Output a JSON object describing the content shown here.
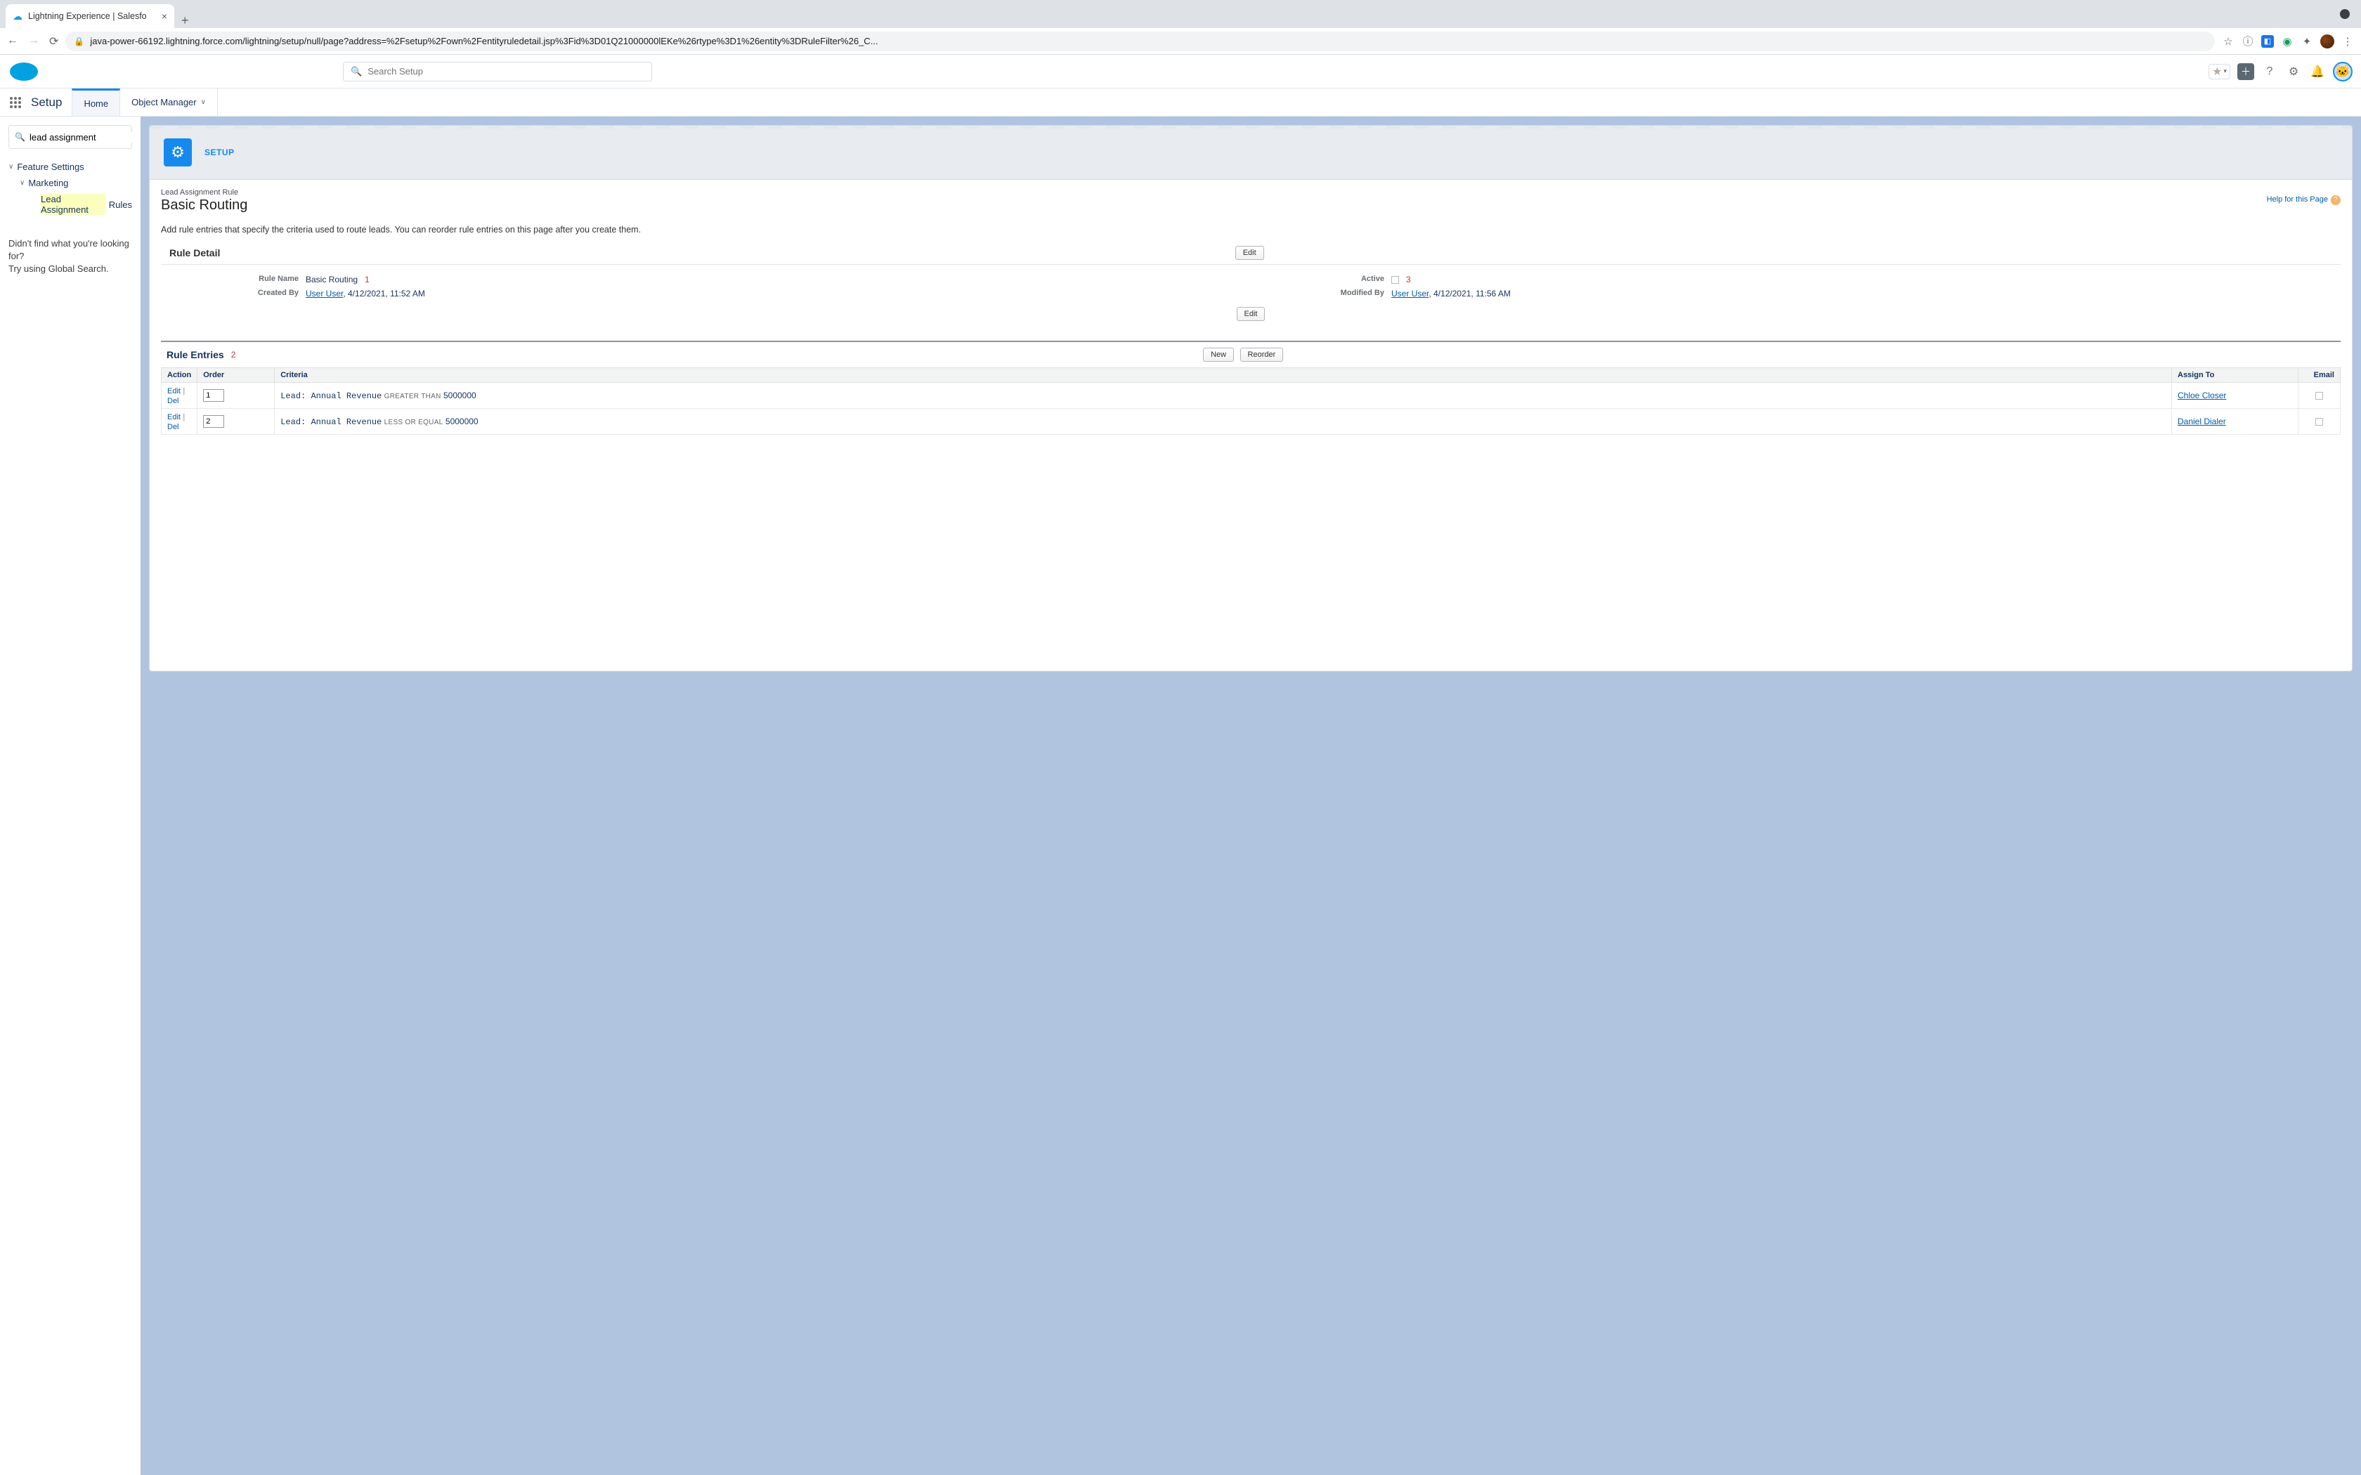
{
  "browser": {
    "tab_title": "Lightning Experience | Salesfo",
    "url": "java-power-66192.lightning.force.com/lightning/setup/null/page?address=%2Fsetup%2Fown%2Fentityruledetail.jsp%3Fid%3D01Q21000000lEKe%26rtype%3D1%26entity%3DRuleFilter%26_C..."
  },
  "globalHeader": {
    "search_placeholder": "Search Setup"
  },
  "contextBar": {
    "app_title": "Setup",
    "tab_home": "Home",
    "tab_object_manager": "Object Manager"
  },
  "sidebar": {
    "search_value": "lead assignment",
    "tree": {
      "feature_settings": "Feature Settings",
      "marketing": "Marketing",
      "lead_assignment_highlight": "Lead Assignment",
      "lead_assignment_rest": " Rules"
    },
    "not_found_line1": "Didn't find what you're looking for?",
    "not_found_line2": "Try using Global Search."
  },
  "banner": {
    "label": "SETUP"
  },
  "page": {
    "subtitle": "Lead Assignment Rule",
    "title": "Basic Routing",
    "help_text": "Help for this Page",
    "description": "Add rule entries that specify the criteria used to route leads. You can reorder rule entries on this page after you create them."
  },
  "ruleDetail": {
    "section": "Rule Detail",
    "edit": "Edit",
    "labels": {
      "rule_name": "Rule Name",
      "active": "Active",
      "created_by": "Created By",
      "modified_by": "Modified By"
    },
    "values": {
      "rule_name": "Basic Routing",
      "created_by_user": "User User",
      "created_by_date": ", 4/12/2021, 11:52 AM",
      "modified_by_user": "User User",
      "modified_by_date": ", 4/12/2021, 11:56 AM"
    },
    "annotations": {
      "a1": "1",
      "a3": "3"
    }
  },
  "ruleEntries": {
    "section": "Rule Entries",
    "annotation": "2",
    "new_btn": "New",
    "reorder_btn": "Reorder",
    "columns": {
      "action": "Action",
      "order": "Order",
      "criteria": "Criteria",
      "assign_to": "Assign To",
      "email": "Email"
    },
    "row_labels": {
      "edit": "Edit",
      "del": "Del"
    },
    "rows": [
      {
        "order": "1",
        "criteria_field": "Lead: Annual Revenue",
        "criteria_op": "GREATER THAN",
        "criteria_val": "5000000",
        "assign_to": "Chloe Closer"
      },
      {
        "order": "2",
        "criteria_field": "Lead: Annual Revenue",
        "criteria_op": "LESS OR EQUAL",
        "criteria_val": "5000000",
        "assign_to": "Daniel Dialer"
      }
    ]
  }
}
